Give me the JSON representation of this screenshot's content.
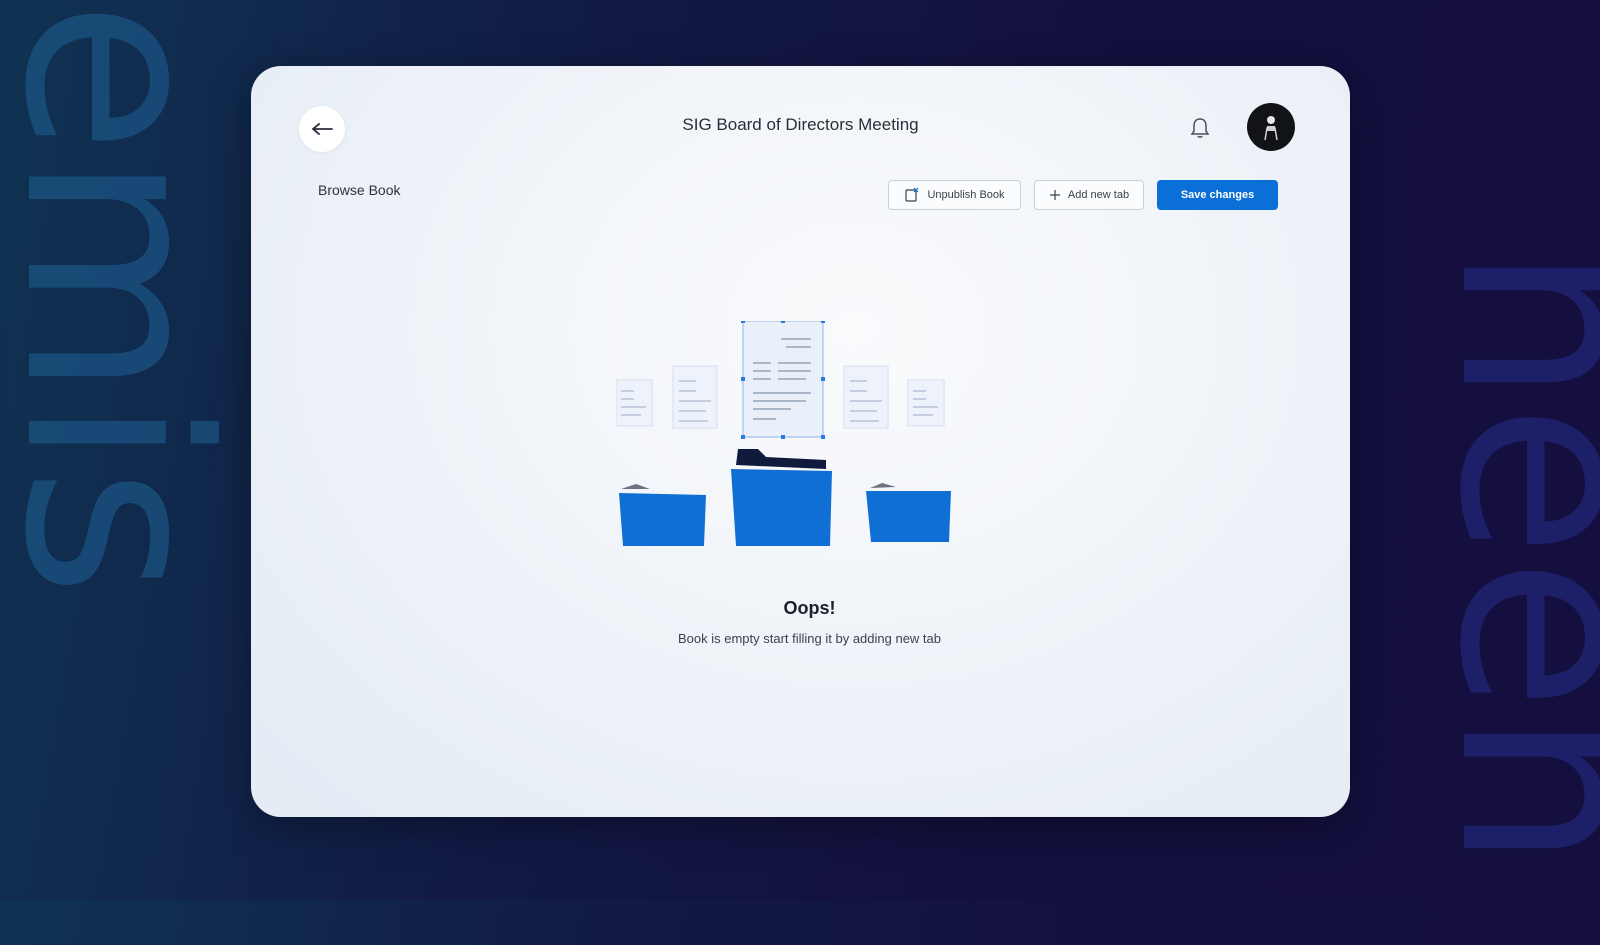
{
  "background": {
    "left_word": "emis",
    "right_word": "neen"
  },
  "header": {
    "title": "SIG Board of Directors Meeting"
  },
  "section": {
    "title": "Browse Book"
  },
  "toolbar": {
    "unpublish_label": "Unpublish Book",
    "add_tab_label": "Add new tab",
    "save_label": "Save changes"
  },
  "empty_state": {
    "title": "Oops!",
    "message": "Book is empty start filling it by adding new tab"
  },
  "colors": {
    "accent": "#0b6fd8",
    "folder": "#0f6fd4",
    "folder_dark": "#0f1a3d"
  },
  "icons": [
    "back-arrow-icon",
    "bell-icon",
    "avatar",
    "unpublish-icon",
    "plus-icon"
  ]
}
